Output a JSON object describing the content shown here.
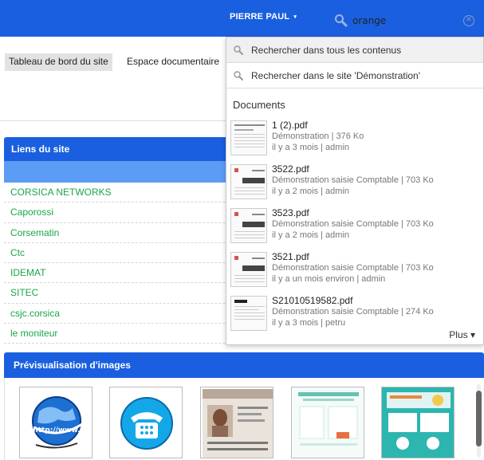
{
  "header": {
    "user_name": "PIERRE PAUL",
    "caret": "▾",
    "search_value": "orange",
    "clear_symbol": "✕"
  },
  "nav": {
    "tabs": [
      {
        "label": "Tableau de bord du site",
        "active": true
      },
      {
        "label": "Espace documentaire",
        "active": false
      }
    ]
  },
  "links_panel": {
    "title": "Liens du site",
    "items": [
      "CORSICA NETWORKS",
      "Caporossi",
      "Corsematin",
      "Ctc",
      "IDEMAT",
      "SITEC",
      "csjc.corsica",
      "le moniteur"
    ]
  },
  "images_panel": {
    "title": "Prévisualisation d'images",
    "thumbs": [
      "globe-www",
      "telephone-icon",
      "identity-card",
      "document-preview",
      "flyer-preview"
    ]
  },
  "search_dropdown": {
    "options": [
      "Rechercher dans tous les contenus",
      "Rechercher dans le site 'Démonstration'"
    ],
    "section_title": "Documents",
    "documents": [
      {
        "title": "1 (2).pdf",
        "meta": "Démonstration | 376 Ko",
        "time": "il y a 3 mois | admin"
      },
      {
        "title": "3522.pdf",
        "meta": "Démonstration saisie Comptable | 703 Ko",
        "time": "il y a 2 mois | admin"
      },
      {
        "title": "3523.pdf",
        "meta": "Démonstration saisie Comptable | 703 Ko",
        "time": "il y a 2 mois | admin"
      },
      {
        "title": "3521.pdf",
        "meta": "Démonstration saisie Comptable | 703 Ko",
        "time": "il y a un mois environ | admin"
      },
      {
        "title": "S21010519582.pdf",
        "meta": "Démonstration saisie Comptable | 274 Ko",
        "time": "il y a 3 mois | petru"
      }
    ],
    "more_label": "Plus ▾"
  },
  "colors": {
    "header_blue": "#1a5fe0",
    "subheader_blue": "#5c9cf5",
    "link_green": "#1aa64a"
  }
}
